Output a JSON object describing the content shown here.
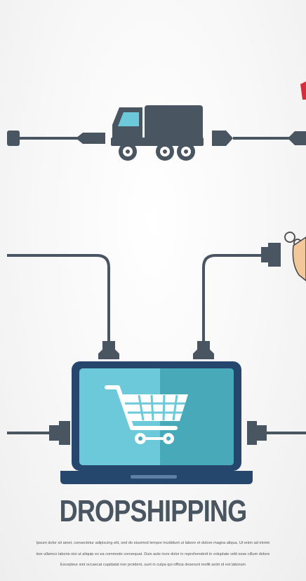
{
  "title": "DROPSHIPPING",
  "caption_lines": [
    "Ipsum dolor sit amet, consectetur adipiscing elit, sed do eiusmod tempor incididunt ut labore et dolore magna aliqua. Ut enim ad minim",
    "tion ullamco laboris nisi ut aliquip ex ea commodo consequat. Duis aute irure dolor in reprehenderit in voluptate velit esse cillum dolore",
    "Excepteur sint occaecat cupidatat non proident, sunt in culpa qui officia deserunt mollit anim id est laborum"
  ],
  "colors": {
    "dark_slate": "#4a5562",
    "screen_light": "#6cc9d9",
    "screen_dark": "#48a9b8",
    "laptop_base": "#25466d",
    "accent_red": "#d62d3c"
  },
  "icons": [
    "truck-icon",
    "laptop-icon",
    "shopping-cart-icon",
    "price-tag-icon",
    "cable-plug-icon"
  ]
}
